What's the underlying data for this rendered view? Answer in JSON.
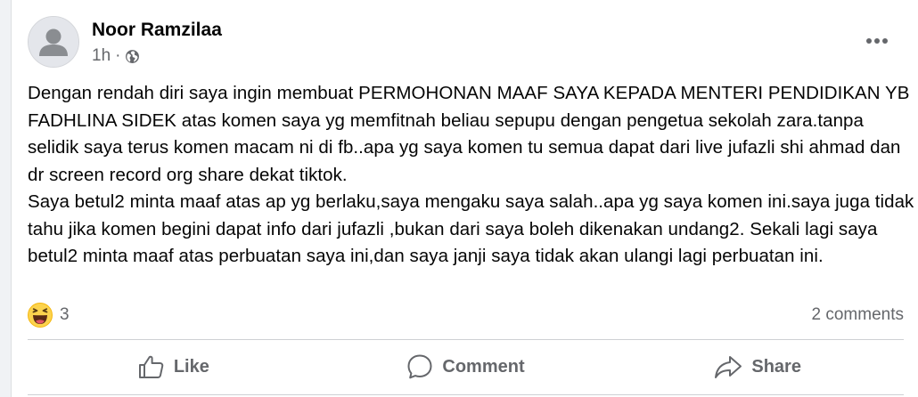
{
  "post": {
    "author": "Noor Ramzilaa",
    "time": "1h",
    "separator": "·",
    "privacy_icon": "globe-icon",
    "more_icon": "more-options-icon",
    "paragraphs": [
      "Dengan rendah diri saya ingin membuat PERMOHONAN MAAF SAYA KEPADA MENTERI PENDIDIKAN YB FADHLINA SIDEK atas komen saya yg memfitnah beliau sepupu dengan pengetua sekolah zara.tanpa selidik saya terus komen macam ni di fb..apa yg saya komen tu semua dapat dari live jufazli shi ahmad dan dr screen record org share dekat tiktok.",
      "Saya betul2 minta maaf atas ap yg berlaku,saya mengaku saya salah..apa yg saya komen ini.saya juga tidak tahu jika komen begini dapat info dari jufazli ,bukan dari saya boleh dikenakan undang2. Sekali lagi saya betul2 minta maaf atas perbuatan saya ini,dan saya janji saya tidak akan ulangi lagi perbuatan ini."
    ]
  },
  "stats": {
    "reaction_icon": "haha-emoji-icon",
    "reaction_count": "3",
    "comments": "2 comments"
  },
  "actions": {
    "like": "Like",
    "comment": "Comment",
    "share": "Share"
  },
  "colors": {
    "background": "#f0f2f5",
    "card": "#ffffff",
    "text": "#050505",
    "secondary_text": "#65676b",
    "divider": "#ced0d4"
  }
}
